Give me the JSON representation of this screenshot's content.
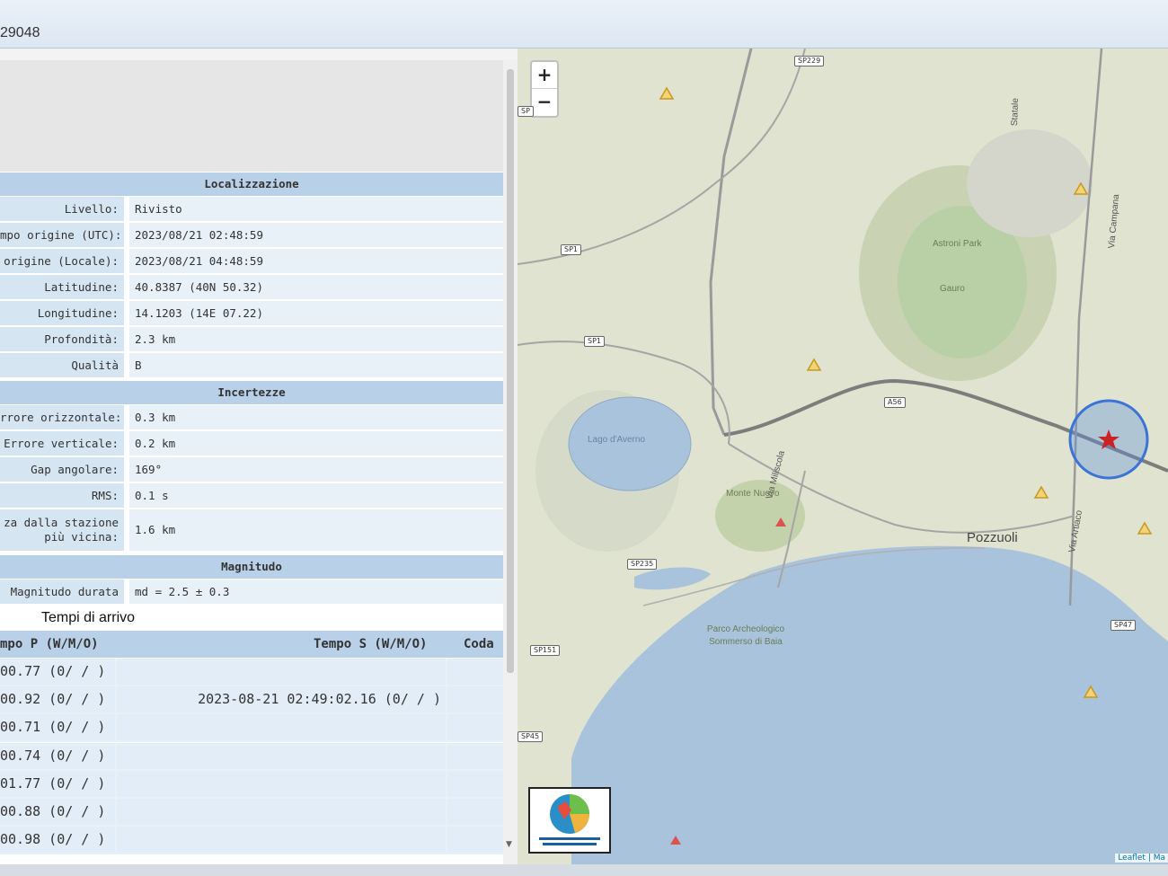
{
  "window": {
    "title": "29048"
  },
  "details": {
    "localizzazione_header": "Localizzazione",
    "rows_loc": [
      {
        "label": "Livello:",
        "value": "Rivisto"
      },
      {
        "label": "mpo origine (UTC):",
        "value": "2023/08/21 02:48:59"
      },
      {
        "label": "origine (Locale):",
        "value": "2023/08/21 04:48:59"
      },
      {
        "label": "Latitudine:",
        "value": "40.8387 (40N 50.32)"
      },
      {
        "label": "Longitudine:",
        "value": "14.1203 (14E 07.22)"
      },
      {
        "label": "Profondità:",
        "value": "2.3 km"
      },
      {
        "label": "Qualità",
        "value": "B"
      }
    ],
    "incertezze_header": "Incertezze",
    "rows_inc": [
      {
        "label": "rrore orizzontale:",
        "value": "0.3 km"
      },
      {
        "label": "Errore verticale:",
        "value": "0.2 km"
      },
      {
        "label": "Gap angolare:",
        "value": "169°"
      },
      {
        "label": "RMS:",
        "value": "0.1 s"
      }
    ],
    "dist_label_1": "za dalla stazione",
    "dist_label_2": "più vicina:",
    "dist_value": "1.6 km",
    "magnitudo_header": "Magnitudo",
    "mag_label": "Magnitudo durata",
    "mag_value": "md = 2.5 ± 0.3"
  },
  "arrivals": {
    "title": "Tempi di arrivo",
    "columns": [
      "mpo P (W/M/O)",
      "Tempo S (W/M/O)",
      "Coda"
    ],
    "rows": [
      {
        "p": "00.77 (0/ / )",
        "s": "",
        "coda": ""
      },
      {
        "p": "00.92 (0/ / )",
        "s": "2023-08-21 02:49:02.16 (0/ / )",
        "coda": ""
      },
      {
        "p": "00.71 (0/ / )",
        "s": "",
        "coda": ""
      },
      {
        "p": "00.74 (0/ / )",
        "s": "",
        "coda": ""
      },
      {
        "p": "01.77 (0/ / )",
        "s": "",
        "coda": ""
      },
      {
        "p": "00.88 (0/ / )",
        "s": "",
        "coda": ""
      },
      {
        "p": "00.98 (0/ / )",
        "s": "",
        "coda": ""
      }
    ]
  },
  "map": {
    "zoom_in": "+",
    "zoom_out": "−",
    "road_labels": [
      "SP229",
      "SP",
      "SP1",
      "SP1",
      "A56",
      "SP235",
      "SP151",
      "SP45",
      "SP47"
    ],
    "place_labels": [
      "Lago d'Averno",
      "Monte Nuovo",
      "Pozzuoli",
      "Parco Archeologico Sommerso di Baia",
      "Astroni Park",
      "Gauro",
      "Via Miliscola",
      "Via Campana",
      "Via Artiaco",
      "Statale"
    ],
    "attribution": "Leaflet | Ma",
    "logo_text": "ISTITUTO NAZIONALE DI GEOFISICA E VULCANOLOGIA",
    "epicenter_color": "#cc2222",
    "water_color": "#a9c3dc",
    "terrain_color": "#dfe3cf"
  }
}
